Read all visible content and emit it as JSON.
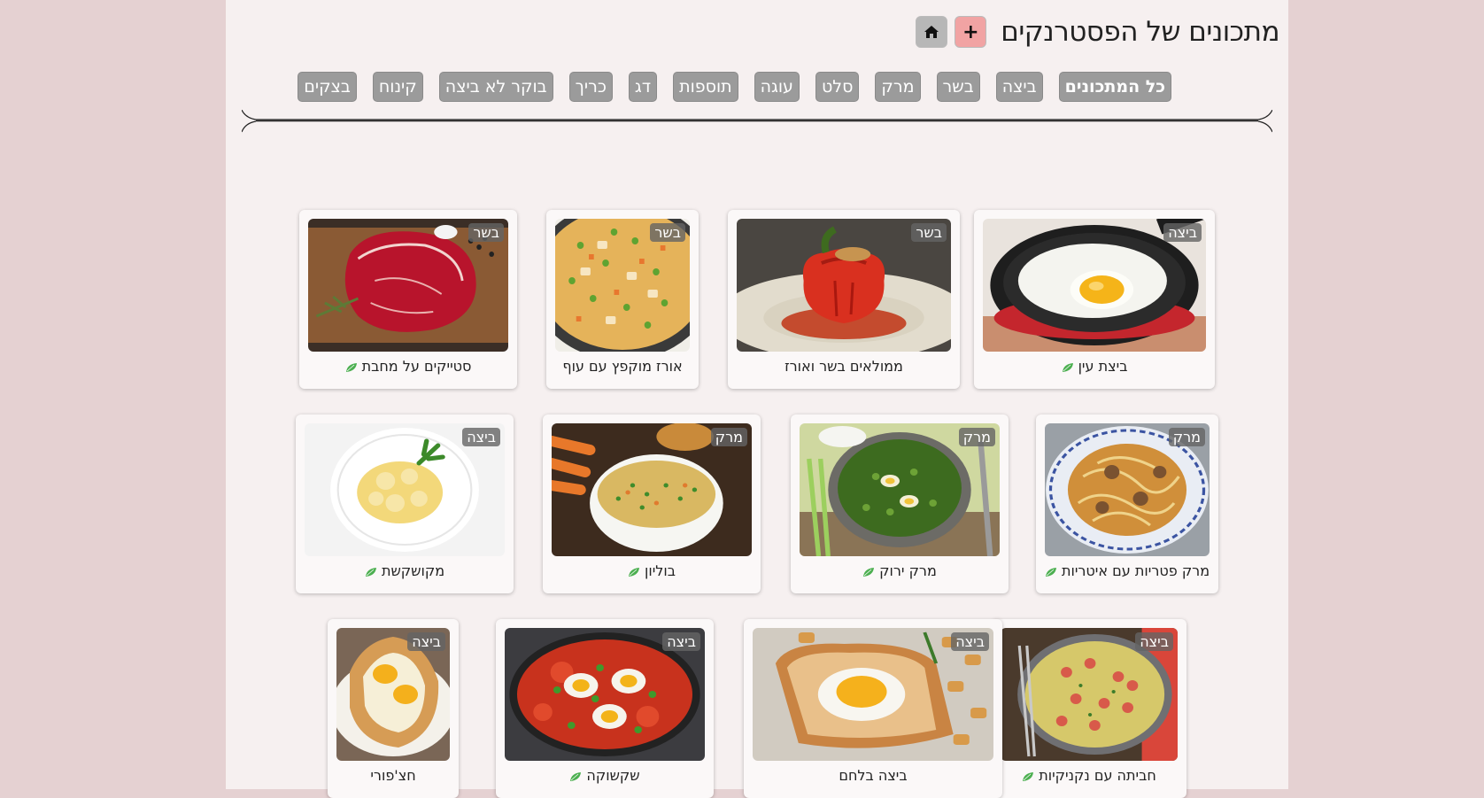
{
  "header": {
    "title": "מתכונים של הפסטרנקים",
    "add_label": "+",
    "home_icon": "home-icon"
  },
  "nav": {
    "items": [
      "כל המתכונים",
      "ביצה",
      "בשר",
      "מרק",
      "סלט",
      "עוגה",
      "תוספות",
      "דג",
      "כריך",
      "בוקר לא ביצה",
      "קינוח",
      "בצקים"
    ],
    "active_index": 0
  },
  "recipes": [
    {
      "title": "ביצת עין",
      "tag": "ביצה",
      "vegetarian": true,
      "image": "fried-egg-pan"
    },
    {
      "title": "ממולאים בשר ואורז",
      "tag": "בשר",
      "vegetarian": false,
      "image": "stuffed-pepper"
    },
    {
      "title": "אורז מוקפץ עם עוף",
      "tag": "בשר",
      "vegetarian": false,
      "image": "fried-rice"
    },
    {
      "title": "סטייקים על מחבת",
      "tag": "בשר",
      "vegetarian": true,
      "image": "raw-steak"
    },
    {
      "title": "מרק פטריות עם איטריות",
      "tag": "מרק",
      "vegetarian": true,
      "image": "mushroom-noodle-soup"
    },
    {
      "title": "מרק ירוק",
      "tag": "מרק",
      "vegetarian": true,
      "image": "green-soup"
    },
    {
      "title": "בוליון",
      "tag": "מרק",
      "vegetarian": true,
      "image": "broth"
    },
    {
      "title": "מקושקשת",
      "tag": "ביצה",
      "vegetarian": true,
      "image": "scrambled-eggs"
    },
    {
      "title": "חביתה עם נקניקיות",
      "tag": "ביצה",
      "vegetarian": true,
      "image": "sausage-omelette"
    },
    {
      "title": "ביצה בלחם",
      "tag": "ביצה",
      "vegetarian": false,
      "image": "egg-in-bread"
    },
    {
      "title": "שקשוקה",
      "tag": "ביצה",
      "vegetarian": true,
      "image": "shakshuka"
    },
    {
      "title": "חצ'פורי",
      "tag": "ביצה",
      "vegetarian": false,
      "image": "khachapuri"
    }
  ],
  "colors": {
    "outer_bg": "#e5d1d2",
    "page_bg": "#f6f0f0",
    "nav_button": "#9b9b9b",
    "add_button": "#f1a3a3",
    "home_button": "#b7b7b7",
    "leaf": "#4caf50"
  }
}
